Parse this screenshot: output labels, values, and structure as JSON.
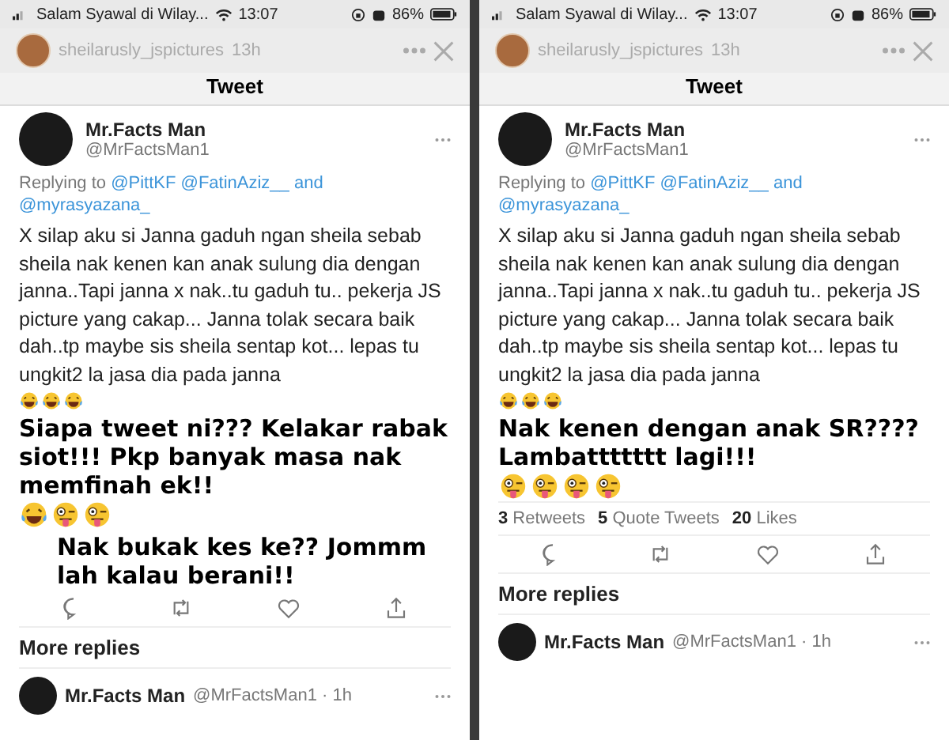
{
  "panels": [
    {
      "status_bar": {
        "carrier": "Salam Syawal di Wilay...",
        "time": "13:07",
        "battery": "86%"
      },
      "story": {
        "username": "sheilarusly_jspictures",
        "age": "13h"
      },
      "title": "Tweet",
      "tweet": {
        "name": "Mr.Facts Man",
        "handle": "@MrFactsMan1",
        "replying_label": "Replying to",
        "reply_to": [
          "@PittKF",
          "@FatinAziz__",
          "and",
          "@myrasyazana_"
        ],
        "body": "X silap aku si Janna gaduh ngan sheila sebab sheila nak kenen kan anak sulung dia dengan janna..Tapi janna x nak..tu gaduh tu.. pekerja JS picture yang cakap... Janna tolak secara baik dah..tp maybe sis sheila sentap kot... lepas tu ungkit2 la jasa dia pada janna",
        "emojis": [
          {
            "kind": "laugh"
          },
          {
            "kind": "laugh"
          },
          {
            "kind": "laugh"
          }
        ]
      },
      "captions": [
        {
          "text": "Siapa tweet ni??? Kelakar rabak siot!!! Pkp banyak masa nak memfinah ek!!",
          "emojis": [
            {
              "kind": "laugh"
            },
            {
              "kind": "silly"
            },
            {
              "kind": "silly"
            }
          ]
        },
        {
          "text": "Nak bukak kes ke?? Jommm lah kalau berani!!"
        }
      ],
      "more_replies": "More replies",
      "reply": {
        "name": "Mr.Facts Man",
        "handle": "@MrFactsMan1 · 1h"
      }
    },
    {
      "status_bar": {
        "carrier": "Salam Syawal di Wilay...",
        "time": "13:07",
        "battery": "86%"
      },
      "story": {
        "username": "sheilarusly_jspictures",
        "age": "13h"
      },
      "title": "Tweet",
      "tweet": {
        "name": "Mr.Facts Man",
        "handle": "@MrFactsMan1",
        "replying_label": "Replying to",
        "reply_to": [
          "@PittKF",
          "@FatinAziz__",
          "and",
          "@myrasyazana_"
        ],
        "body": "X silap aku si Janna gaduh ngan sheila sebab sheila nak kenen kan anak sulung dia dengan janna..Tapi janna x nak..tu gaduh tu.. pekerja JS picture yang cakap... Janna tolak secara baik dah..tp maybe sis sheila sentap kot... lepas tu ungkit2 la jasa dia pada janna",
        "emojis": [
          {
            "kind": "laugh"
          },
          {
            "kind": "laugh"
          },
          {
            "kind": "laugh"
          }
        ]
      },
      "captions": [
        {
          "text": "Nak kenen dengan anak SR???? Lambattttttt lagi!!!",
          "emojis": [
            {
              "kind": "silly"
            },
            {
              "kind": "silly"
            },
            {
              "kind": "silly"
            },
            {
              "kind": "silly"
            }
          ]
        }
      ],
      "stats": [
        {
          "count": "3",
          "label": "Retweets"
        },
        {
          "count": "5",
          "label": "Quote Tweets"
        },
        {
          "count": "20",
          "label": "Likes"
        }
      ],
      "more_replies": "More replies",
      "reply": {
        "name": "Mr.Facts Man",
        "handle": "@MrFactsMan1 · 1h"
      }
    }
  ]
}
